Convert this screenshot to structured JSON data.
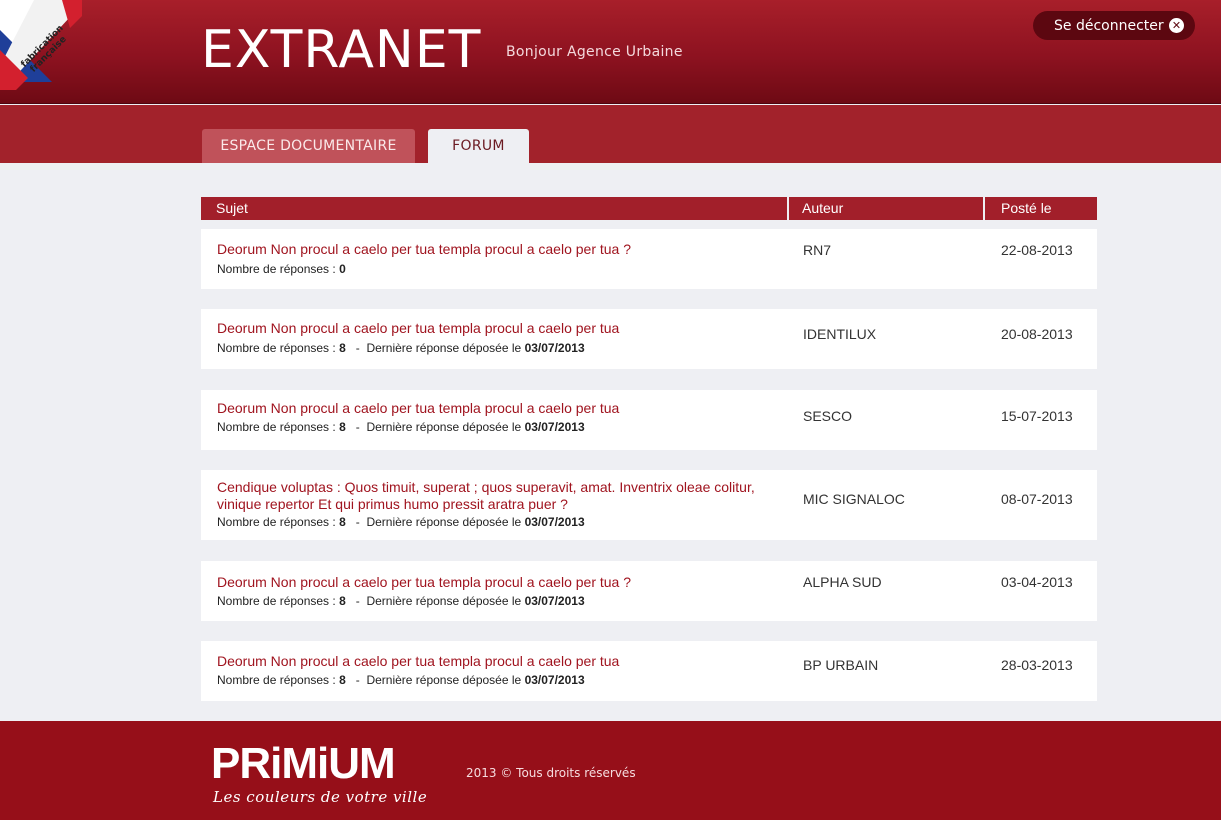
{
  "header": {
    "badge_text_line1": "fabrication",
    "badge_text_line2": "française",
    "brand_title": "EXTRANET",
    "greeting": "Bonjour Agence Urbaine",
    "logout_label": "Se déconnecter"
  },
  "tabs": [
    {
      "label": "ESPACE DOCUMENTAIRE",
      "active": false
    },
    {
      "label": "FORUM",
      "active": true
    }
  ],
  "table": {
    "columns": [
      "Sujet",
      "Auteur",
      "Posté le"
    ],
    "meta_replies_label": "Nombre de réponses :",
    "meta_last_label": "Dernière réponse déposée le",
    "rows": [
      {
        "subject": "Deorum Non procul a caelo per tua templa procul a caelo per tua ?",
        "replies": "0",
        "last_reply": "",
        "author": "RN7",
        "date": "22-08-2013"
      },
      {
        "subject": "Deorum Non procul a caelo per tua templa procul a caelo per tua",
        "replies": "8",
        "last_reply": "03/07/2013",
        "author": "IDENTILUX",
        "date": "20-08-2013"
      },
      {
        "subject": "Deorum Non procul a caelo per tua templa procul a caelo per tua",
        "replies": "8",
        "last_reply": "03/07/2013",
        "author": "SESCO",
        "date": "15-07-2013"
      },
      {
        "subject": "Cendique voluptas : Quos timuit, superat ; quos superavit, amat. Inventrix oleae colitur, vinique repertor Et qui primus humo pressit aratra puer ?",
        "replies": "8",
        "last_reply": "03/07/2013",
        "author": "MIC SIGNALOC",
        "date": "08-07-2013"
      },
      {
        "subject": "Deorum Non procul a caelo per tua templa procul a caelo per tua ?",
        "replies": "8",
        "last_reply": "03/07/2013",
        "author": "ALPHA SUD",
        "date": "03-04-2013"
      },
      {
        "subject": "Deorum Non procul a caelo per tua templa procul a caelo per tua",
        "replies": "8",
        "last_reply": "03/07/2013",
        "author": "BP URBAIN",
        "date": "28-03-2013"
      }
    ]
  },
  "footer": {
    "logo_word": "PRiMiUM",
    "logo_tagline": "Les couleurs de votre ville",
    "copyright": "2013 © Tous droits réservés"
  },
  "colors": {
    "brand_red": "#960f19",
    "link_red": "#a0141f",
    "background": "#eeeff3"
  }
}
